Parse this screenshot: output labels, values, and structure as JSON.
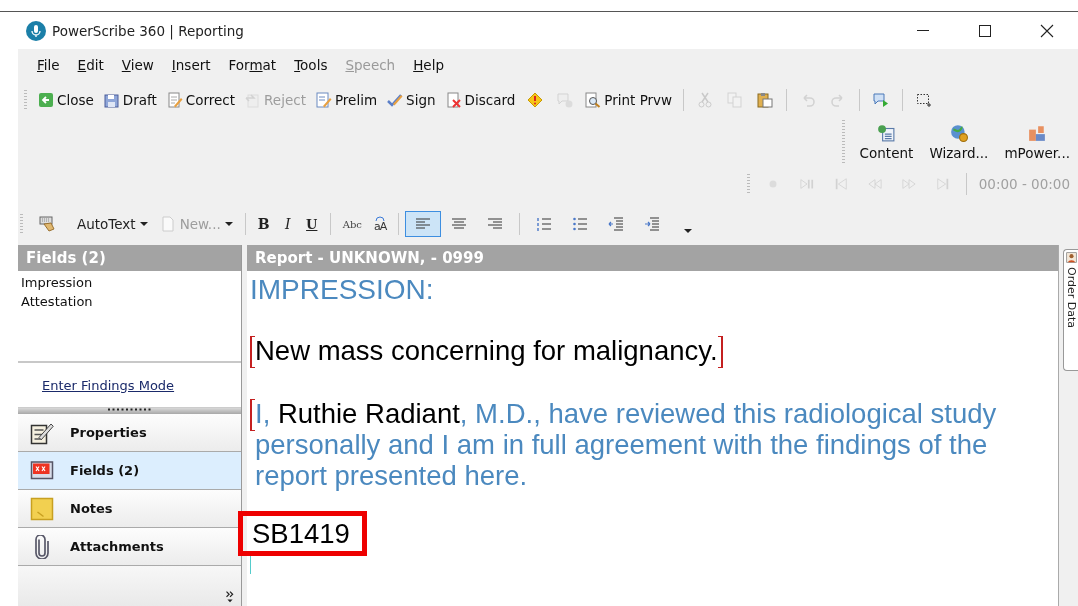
{
  "window": {
    "title": "PowerScribe 360 | Reporting"
  },
  "menu": [
    {
      "label": "File",
      "disabled": false
    },
    {
      "label": "Edit",
      "disabled": false
    },
    {
      "label": "View",
      "disabled": false
    },
    {
      "label": "Insert",
      "disabled": false
    },
    {
      "label": "Format",
      "disabled": false
    },
    {
      "label": "Tools",
      "disabled": false
    },
    {
      "label": "Speech",
      "disabled": true
    },
    {
      "label": "Help",
      "disabled": false
    }
  ],
  "toolbar": [
    {
      "kind": "button",
      "label": "Close",
      "disabled": false
    },
    {
      "kind": "button",
      "label": "Draft",
      "disabled": false
    },
    {
      "kind": "button",
      "label": "Correct",
      "disabled": false
    },
    {
      "kind": "button",
      "label": "Reject",
      "disabled": true
    },
    {
      "kind": "button",
      "label": "Prelim",
      "disabled": false
    },
    {
      "kind": "button",
      "label": "Sign",
      "disabled": false
    },
    {
      "kind": "button",
      "label": "Discard",
      "disabled": false
    },
    {
      "kind": "icon",
      "disabled": false
    },
    {
      "kind": "icon",
      "disabled": true
    },
    {
      "kind": "button",
      "label": "Print Prvw",
      "disabled": false
    },
    {
      "kind": "separator"
    },
    {
      "kind": "icon",
      "disabled": true
    },
    {
      "kind": "icon",
      "disabled": true
    },
    {
      "kind": "icon",
      "disabled": false
    },
    {
      "kind": "separator"
    },
    {
      "kind": "icon",
      "disabled": true
    },
    {
      "kind": "icon",
      "disabled": true
    },
    {
      "kind": "separator"
    },
    {
      "kind": "icon",
      "disabled": false
    },
    {
      "kind": "separator"
    },
    {
      "kind": "icon",
      "disabled": false
    }
  ],
  "tools_toolbar": [
    {
      "label": "Content"
    },
    {
      "label": "Wizard..."
    },
    {
      "label": "mPower..."
    }
  ],
  "playback": {
    "buttons": [
      {
        "disabled": true
      },
      {
        "disabled": true
      },
      {
        "disabled": true
      },
      {
        "disabled": true
      },
      {
        "disabled": true
      },
      {
        "disabled": true
      }
    ],
    "time": "00:00 - 00:00",
    "time_disabled": true
  },
  "format_toolbar": [
    {
      "kind": "icon"
    },
    {
      "kind": "dropdown",
      "label": "AutoText",
      "disabled": false
    },
    {
      "kind": "dropdown",
      "label": "New...",
      "disabled": true
    },
    {
      "kind": "separator"
    },
    {
      "kind": "text",
      "label": "B"
    },
    {
      "kind": "text",
      "label": "I"
    },
    {
      "kind": "text",
      "label": "U"
    },
    {
      "kind": "separator"
    },
    {
      "kind": "text",
      "label": "Abc"
    },
    {
      "kind": "text",
      "label": "aA"
    },
    {
      "kind": "separator"
    },
    {
      "kind": "icon",
      "selected": true
    },
    {
      "kind": "icon",
      "selected": false
    },
    {
      "kind": "icon",
      "selected": false
    },
    {
      "kind": "separator"
    },
    {
      "kind": "icon"
    },
    {
      "kind": "icon"
    },
    {
      "kind": "icon"
    },
    {
      "kind": "icon"
    },
    {
      "kind": "overflow"
    }
  ],
  "sidebar": {
    "title": "Fields (2)",
    "fields": [
      "Impression",
      "Attestation"
    ],
    "link": "Enter Findings Mode",
    "nav": [
      {
        "label": "Properties",
        "selected": false
      },
      {
        "label": "Fields (2)",
        "selected": true
      },
      {
        "label": "Notes",
        "selected": false
      },
      {
        "label": "Attachments",
        "selected": false
      }
    ]
  },
  "report": {
    "title": "Report - UNKNOWN, - 0999",
    "blocks": [
      {
        "kind": "heading",
        "text": "IMPRESSION:"
      },
      {
        "kind": "field",
        "open_bracket": true,
        "close_bracket": true,
        "segments": [
          {
            "kind": "filled",
            "text": "New mass concerning for malignancy."
          }
        ]
      },
      {
        "kind": "field",
        "open_bracket": true,
        "close_bracket": false,
        "segments": [
          {
            "kind": "template",
            "text": "I, "
          },
          {
            "kind": "filled",
            "text": "Ruthie Radiant"
          },
          {
            "kind": "template",
            "text": ", M.D., have reviewed this radiological study personally and I am in full agreement with the findings of the report presented here."
          }
        ]
      },
      {
        "kind": "plain",
        "text": "SB1419",
        "highlighted": true
      }
    ]
  },
  "side_tab": {
    "label": "Order Data"
  }
}
